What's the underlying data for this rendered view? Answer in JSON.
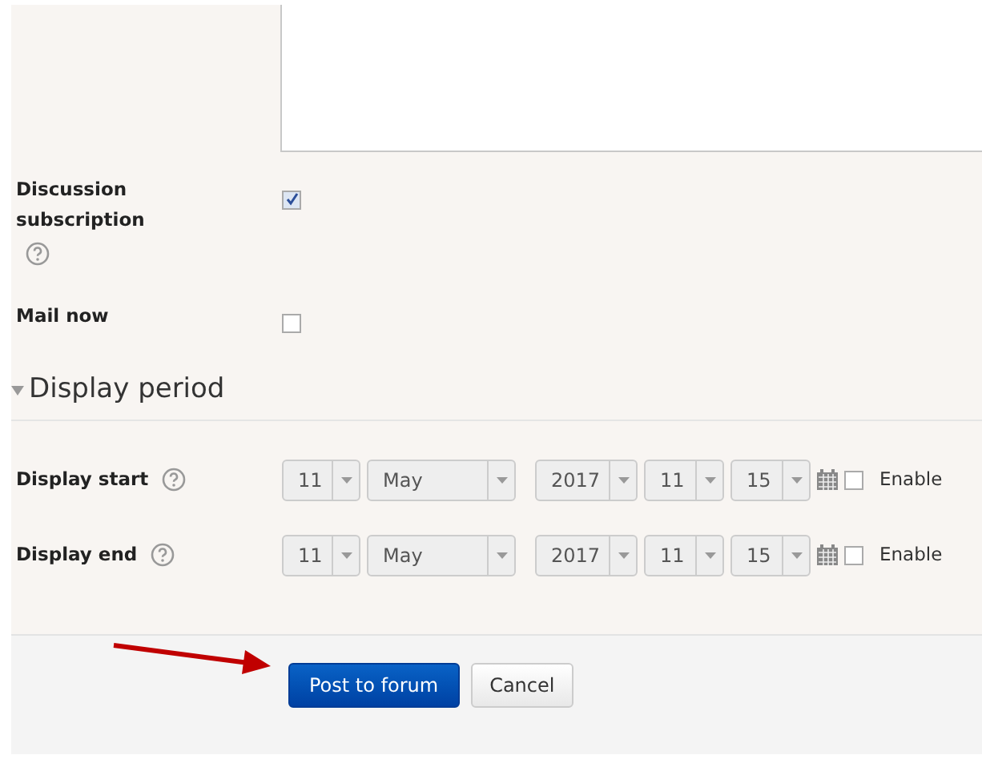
{
  "options": [
    {
      "label": "Discussion subscription",
      "checked": true,
      "help": true
    },
    {
      "label": "Mail now",
      "checked": false,
      "help": false
    }
  ],
  "display_period": {
    "title": "Display period",
    "expanded": true,
    "rows": [
      {
        "label": "Display start",
        "day": "11",
        "month": "May",
        "year": "2017",
        "hour": "11",
        "minute": "15",
        "enable_label": "Enable",
        "enabled": false
      },
      {
        "label": "Display end",
        "day": "11",
        "month": "May",
        "year": "2017",
        "hour": "11",
        "minute": "15",
        "enable_label": "Enable",
        "enabled": false
      }
    ]
  },
  "buttons": [
    {
      "label": "Post to forum",
      "kind": "primary"
    },
    {
      "label": "Cancel",
      "kind": "secondary"
    }
  ]
}
